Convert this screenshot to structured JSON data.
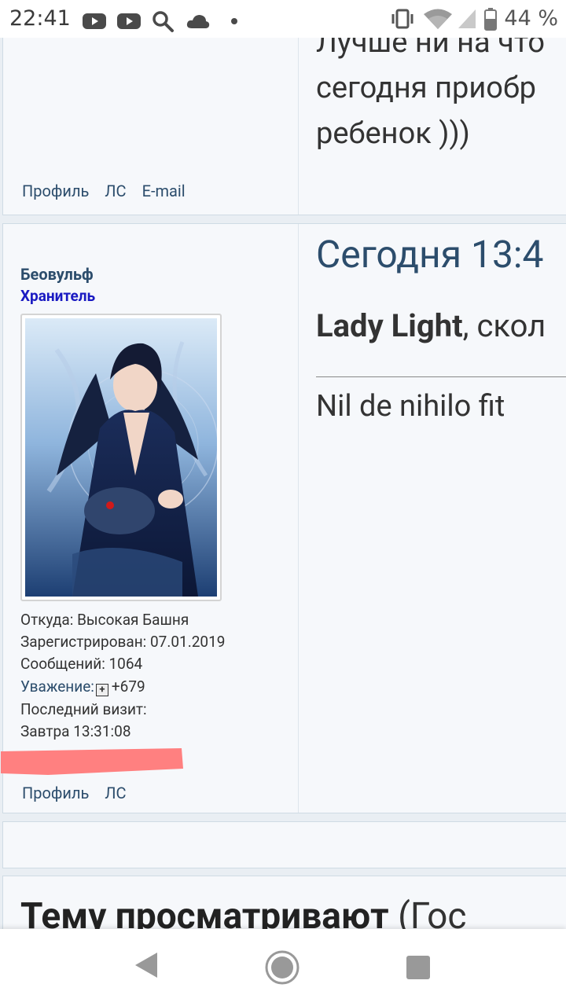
{
  "status_bar": {
    "time": "22:41",
    "left_icons": [
      "youtube-icon",
      "youtube-icon",
      "search-icon",
      "cloud-icon",
      "dot-icon"
    ],
    "right_icons": [
      "vibrate-icon",
      "wifi-icon",
      "signal-icon",
      "battery-icon"
    ],
    "battery": "44 %"
  },
  "post_prev": {
    "message_lines": [
      "Лучше ни на что",
      "сегодня приобр",
      "ребенок )))"
    ],
    "links": [
      "Профиль",
      "ЛС",
      "E-mail"
    ]
  },
  "post": {
    "author": "Беовульф",
    "rank": "Хранитель",
    "avatar_alt": "avatar",
    "from_label": "Откуда: Высокая Башня",
    "registered_label": "Зарегистрирован: 07.01.2019",
    "messages_label": "Сообщений: 1064",
    "respect_label": "Уважение:",
    "respect_icon": "+",
    "respect_value": "+679",
    "last_visit_label": "Последний визит:",
    "last_visit_value": "Завтра 13:31:08",
    "date": "Сегодня 13:4",
    "quote_name": "Lady Light",
    "quote_rest": ", скол",
    "signature": "Nil de nihilo fit",
    "links": [
      "Профиль",
      "ЛС"
    ]
  },
  "who_viewing": {
    "title": "Тему просматривают",
    "rest": " (Гос"
  },
  "colors": {
    "link": "#2c4d6c",
    "rank": "#1a1ac2",
    "highlight": "#ff8080"
  }
}
